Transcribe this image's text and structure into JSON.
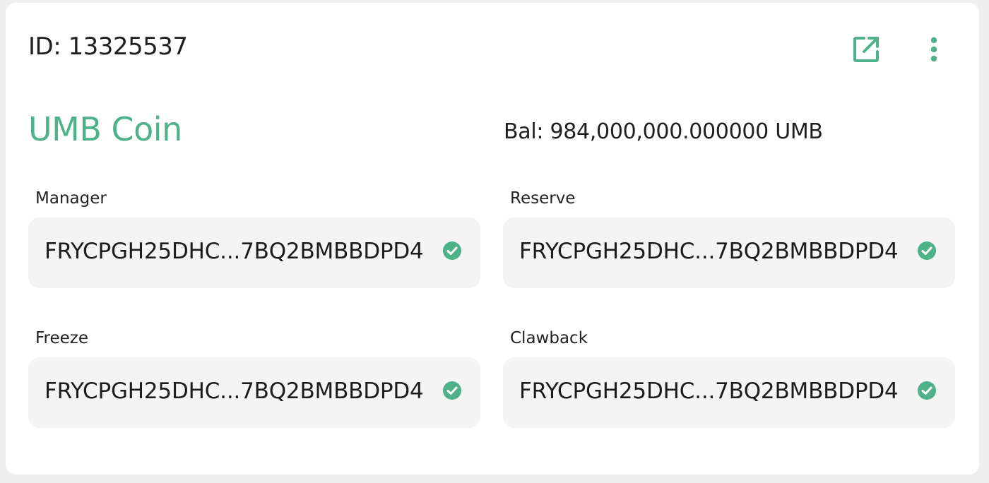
{
  "asset": {
    "id_text": "ID: 13325537",
    "name": "UMB Coin",
    "balance_text": "Bal: 984,000,000.000000 UMB"
  },
  "fields": [
    {
      "label": "Manager",
      "value": "FRYCPGH25DHC...7BQ2BMBBDPD4",
      "status_icon": "check-circle-icon"
    },
    {
      "label": "Reserve",
      "value": "FRYCPGH25DHC...7BQ2BMBBDPD4",
      "status_icon": "check-circle-icon"
    },
    {
      "label": "Freeze",
      "value": "FRYCPGH25DHC...7BQ2BMBBDPD4",
      "status_icon": "check-circle-icon"
    },
    {
      "label": "Clawback",
      "value": "FRYCPGH25DHC...7BQ2BMBBDPD4",
      "status_icon": "check-circle-icon"
    }
  ],
  "actions": {
    "open_icon": "open-in-new-icon",
    "menu_icon": "more-vertical-icon"
  },
  "colors": {
    "accent": "#4fb18a",
    "field_bg": "#f4f4f4",
    "card_bg": "#ffffff",
    "page_bg": "#efefef"
  }
}
